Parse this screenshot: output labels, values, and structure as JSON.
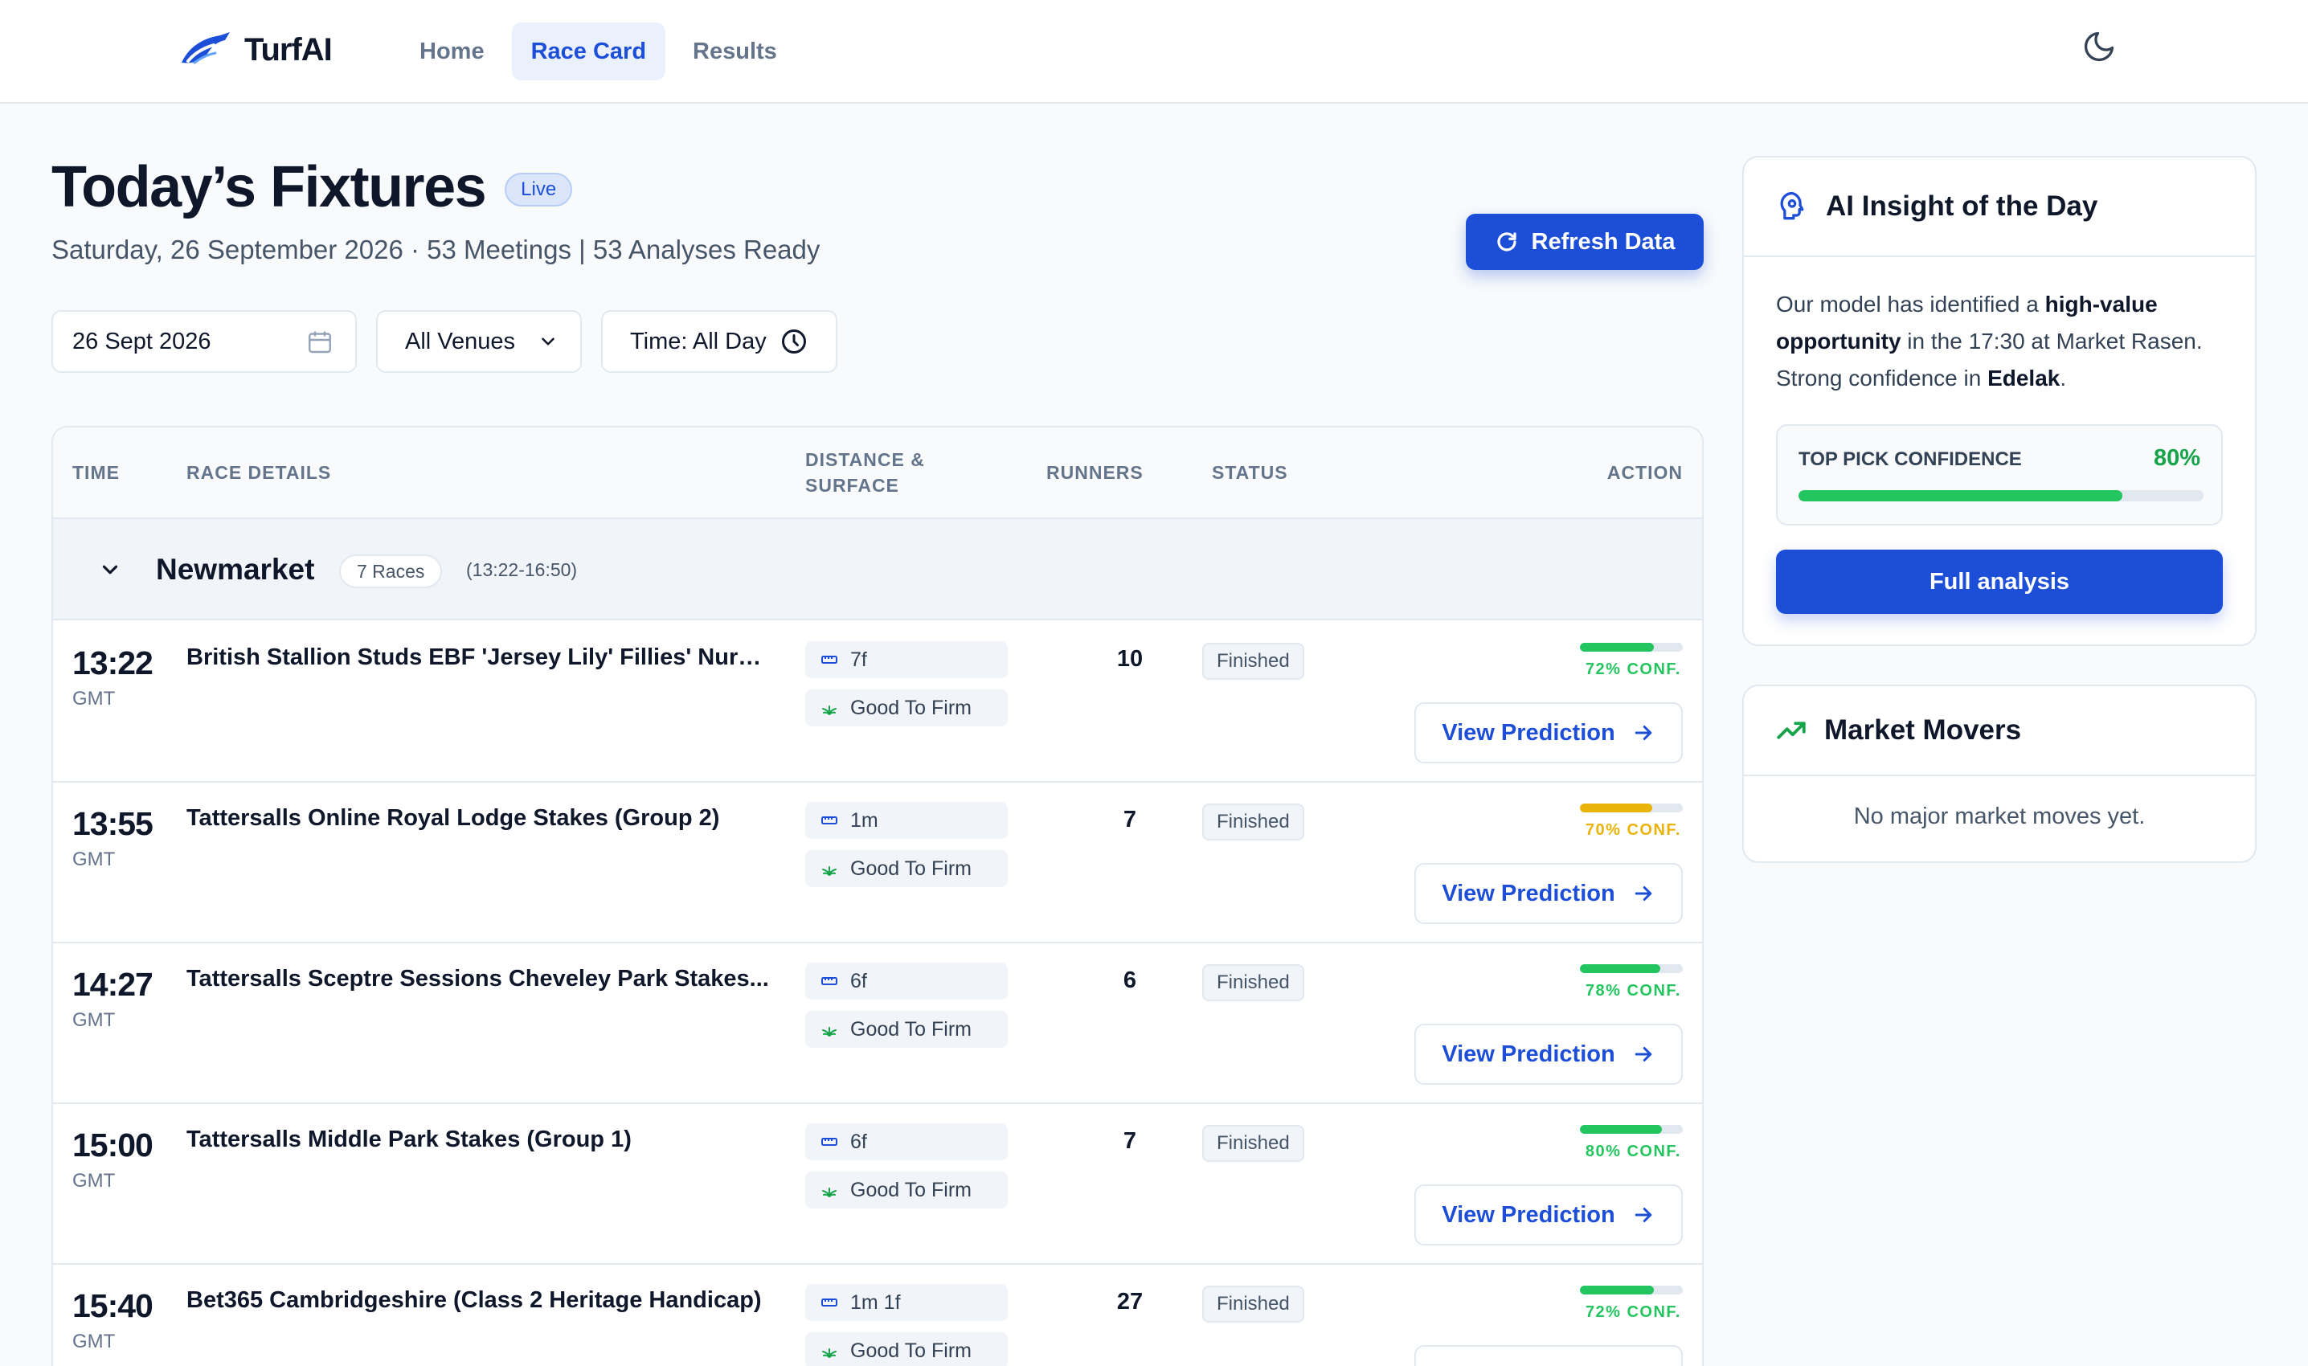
{
  "brand": {
    "name": "TurfAI"
  },
  "nav": {
    "links": [
      "Home",
      "Race Card",
      "Results"
    ],
    "active": "Race Card"
  },
  "page": {
    "title": "Today’s Fixtures",
    "badge": "Live",
    "subtitle": "Saturday, 26 September 2026 · 53 Meetings | 53 Analyses Ready",
    "refresh_label": "Refresh Data"
  },
  "filters": {
    "date": "26 Sept 2026",
    "venue": "All Venues",
    "time": "Time: All Day"
  },
  "table": {
    "headers": {
      "time": "TIME",
      "details": "RACE DETAILS",
      "distance_1": "DISTANCE &",
      "distance_2": "SURFACE",
      "runners": "RUNNERS",
      "status": "STATUS",
      "action": "ACTION"
    },
    "venue": {
      "name": "Newmarket",
      "races": "7 Races",
      "range": "(13:22-16:50)"
    },
    "rows": [
      {
        "time": "13:22",
        "tz": "GMT",
        "name": "British Stallion Studs EBF 'Jersey Lily' Fillies' Nurse...",
        "distance": "7f",
        "surface": "Good To Firm",
        "runners": "10",
        "status": "Finished",
        "confidence": 72,
        "confidence_label": "72% CONF.",
        "color": "#22c55e",
        "action": "View Prediction"
      },
      {
        "time": "13:55",
        "tz": "GMT",
        "name": "Tattersalls Online Royal Lodge Stakes (Group 2)",
        "distance": "1m",
        "surface": "Good To Firm",
        "runners": "7",
        "status": "Finished",
        "confidence": 70,
        "confidence_label": "70% CONF.",
        "color": "#eab308",
        "action": "View Prediction"
      },
      {
        "time": "14:27",
        "tz": "GMT",
        "name": "Tattersalls Sceptre Sessions Cheveley Park Stakes...",
        "distance": "6f",
        "surface": "Good To Firm",
        "runners": "6",
        "status": "Finished",
        "confidence": 78,
        "confidence_label": "78% CONF.",
        "color": "#22c55e",
        "action": "View Prediction"
      },
      {
        "time": "15:00",
        "tz": "GMT",
        "name": "Tattersalls Middle Park Stakes (Group 1)",
        "distance": "6f",
        "surface": "Good To Firm",
        "runners": "7",
        "status": "Finished",
        "confidence": 80,
        "confidence_label": "80% CONF.",
        "color": "#22c55e",
        "action": "View Prediction"
      },
      {
        "time": "15:40",
        "tz": "GMT",
        "name": "Bet365 Cambridgeshire (Class 2 Heritage Handicap)",
        "distance": "1m 1f",
        "surface": "Good To Firm",
        "runners": "27",
        "status": "Finished",
        "confidence": 72,
        "confidence_label": "72% CONF.",
        "color": "#22c55e",
        "action": "View Prediction"
      }
    ]
  },
  "insight": {
    "title": "AI Insight of the Day",
    "text_1": "Our model has identified a ",
    "text_bold_1": "high-value opportunity",
    "text_2": " in the 17:30 at Market Rasen. Strong confidence in ",
    "text_bold_2": "Edelak",
    "text_3": ".",
    "confidence_label": "TOP PICK CONFIDENCE",
    "confidence_value": "80%",
    "confidence": 80,
    "button": "Full analysis"
  },
  "market": {
    "title": "Market Movers",
    "empty": "No major market moves yet."
  },
  "colors": {
    "accent": "#1d4ed8",
    "success": "#22c55e",
    "warning": "#eab308"
  }
}
